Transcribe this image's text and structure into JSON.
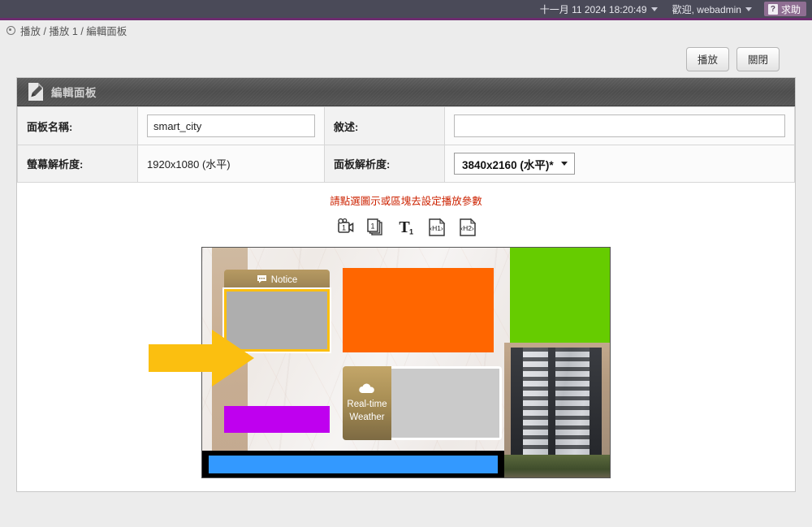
{
  "topbar": {
    "datetime": "十一月 11 2024 18:20:49",
    "user_greeting": "歡迎, webadmin",
    "help_label": "求助",
    "help_mark": "?",
    "help_bg": "#8f6e92",
    "bar_bg": "#4a4a58",
    "accent_rule": "#6d2c6f"
  },
  "breadcrumb": {
    "home_icon": "target-icon",
    "path": "播放 / 播放 1 / 編輯面板"
  },
  "actions": {
    "play_label": "播放",
    "close_label": "關閉"
  },
  "panel": {
    "icon": "document-pen-icon",
    "title": "編輯面板",
    "fields": {
      "panel_name_label": "面板名稱:",
      "panel_name_value": "smart_city",
      "panel_name_placeholder": "",
      "description_label": "敘述:",
      "description_value": "",
      "description_placeholder": "",
      "screen_resolution_label": "螢幕解析度:",
      "screen_resolution_value": "1920x1080 (水平)",
      "panel_resolution_label": "面板解析度:",
      "panel_resolution_value": "3840x2160 (水平)*"
    }
  },
  "editor": {
    "hint": "請點選圖示或區塊去設定播放參數",
    "tools": [
      {
        "name": "video-camera-1-icon",
        "label": "1"
      },
      {
        "name": "stacked-pages-1-icon",
        "label": "1"
      },
      {
        "name": "text-t1-icon",
        "label": "T"
      },
      {
        "name": "document-h1-icon",
        "label": "H1"
      },
      {
        "name": "document-h2-icon",
        "label": "H2"
      }
    ],
    "canvas": {
      "notice_zone": {
        "title": "Notice",
        "icon": "speech-bubble-icon",
        "header_color": "#a98c58",
        "body_color": "#aeaeae",
        "selected_outline": "#fbbf10"
      },
      "weather_zone": {
        "title_line1": "Real-time",
        "title_line2": "Weather",
        "icon": "cloud-icon",
        "label_color": "#a98f55",
        "content_color": "#cacaca"
      },
      "orange_zone": {
        "color": "#ff6600"
      },
      "green_zone": {
        "color": "#66cc00"
      },
      "magenta_zone": {
        "color": "#bf00ef"
      },
      "blue_zone": {
        "color": "#3399ff"
      },
      "building_zone": {
        "kind": "building-photo"
      },
      "arrow_overlay": {
        "name": "yellow-arrow-pointer",
        "color": "#fbbf10"
      }
    }
  }
}
